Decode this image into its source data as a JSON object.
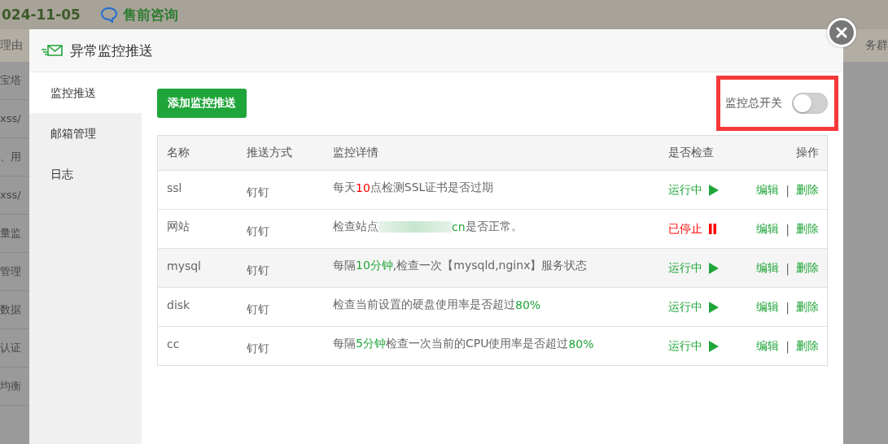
{
  "background": {
    "date": "024-11-05",
    "presale": "售前咨询",
    "line_2_left": "理由",
    "line_2_right": "务群",
    "side_items": [
      "宝塔",
      "xss/",
      "、用",
      "xss/",
      "量监",
      "管理",
      "数据",
      "认证",
      "均衡"
    ]
  },
  "dialog": {
    "title": "异常监控推送",
    "sidebar": [
      {
        "label": "监控推送",
        "selected": true
      },
      {
        "label": "邮箱管理",
        "selected": false
      },
      {
        "label": "日志",
        "selected": false
      }
    ],
    "add_button": "添加监控推送",
    "master_switch": {
      "label": "监控总开关",
      "on": false
    },
    "table": {
      "columns": [
        "名称",
        "推送方式",
        "监控详情",
        "是否检查",
        "操作"
      ],
      "rows": [
        {
          "name": "ssl",
          "method": "钉钉",
          "detail": [
            {
              "kind": "text",
              "text": "每天",
              "color": "#666666"
            },
            {
              "kind": "text",
              "text": "10",
              "color": "#ff0000"
            },
            {
              "kind": "text",
              "text": "点检测SSL证书是否过期",
              "color": "#666666"
            }
          ],
          "status": "运行中",
          "running": true,
          "actions": [
            "编辑",
            "|",
            "删除"
          ]
        },
        {
          "name": "网站",
          "method": "钉钉",
          "detail": [
            {
              "kind": "text",
              "text": "检查站点",
              "color": "#666666"
            },
            {
              "kind": "blurred"
            },
            {
              "kind": "text",
              "text": "cn",
              "color": "#20a53a"
            },
            {
              "kind": "text",
              "text": "是否正常。",
              "color": "#666666"
            }
          ],
          "status": "已停止",
          "running": false,
          "actions": [
            "编辑",
            "|",
            "删除"
          ]
        },
        {
          "name": "mysql",
          "method": "钉钉",
          "detail": [
            {
              "kind": "text",
              "text": "每隔",
              "color": "#666666"
            },
            {
              "kind": "text",
              "text": "10分钟",
              "color": "#20a53a"
            },
            {
              "kind": "text",
              "text": ",检查一次【mysqld,nginx】服务状态",
              "color": "#666666"
            }
          ],
          "status": "运行中",
          "running": true,
          "actions": [
            "编辑",
            "|",
            "删除"
          ]
        },
        {
          "name": "disk",
          "method": "钉钉",
          "detail": [
            {
              "kind": "text",
              "text": "检查当前设置的硬盘使用率是否超过",
              "color": "#666666"
            },
            {
              "kind": "text",
              "text": "80%",
              "color": "#20a53a"
            }
          ],
          "status": "运行中",
          "running": true,
          "actions": [
            "编辑",
            "|",
            "删除"
          ]
        },
        {
          "name": "cc",
          "method": "钉钉",
          "detail": [
            {
              "kind": "text",
              "text": "每隔",
              "color": "#666666"
            },
            {
              "kind": "text",
              "text": "5分钟",
              "color": "#20a53a"
            },
            {
              "kind": "text",
              "text": "检查一次当前的CPU使用率是否超过",
              "color": "#666666"
            },
            {
              "kind": "text",
              "text": "80%",
              "color": "#20a53a"
            }
          ],
          "status": "运行中",
          "running": true,
          "actions": [
            "编辑",
            "|",
            "删除"
          ]
        }
      ]
    }
  }
}
